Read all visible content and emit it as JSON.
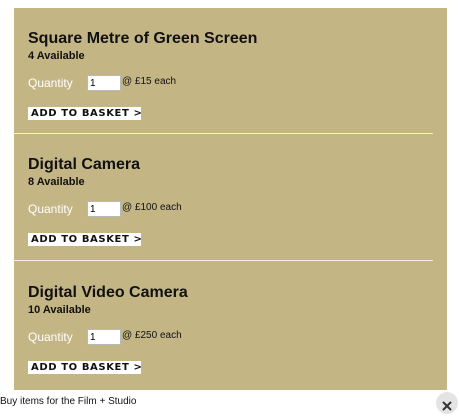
{
  "products": [
    {
      "title": "Square Metre of Green Screen",
      "stock": "4 Available",
      "quantity_label": "Quantity",
      "quantity_value": "1",
      "price": "@ £15 each",
      "add_label": "ADD TO BASKET >"
    },
    {
      "title": "Digital Camera",
      "stock": "8 Available",
      "quantity_label": "Quantity",
      "quantity_value": "1",
      "price": "@ £100 each",
      "add_label": "ADD TO BASKET >"
    },
    {
      "title": "Digital Video Camera",
      "stock": "10 Available",
      "quantity_label": "Quantity",
      "quantity_value": "1",
      "price": "@ £250 each",
      "add_label": "ADD TO BASKET >"
    }
  ],
  "footer": {
    "title": "Buy items for the Film + Studio",
    "close_icon": "close-icon"
  },
  "colors": {
    "panel_background": "#c4b585",
    "quantity_label": "#ffffff",
    "divider": "#f4efe0"
  }
}
